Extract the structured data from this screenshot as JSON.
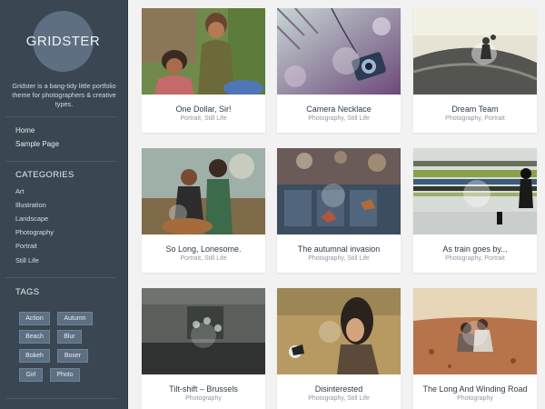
{
  "site": {
    "logo_text": "GRIDSTER",
    "tagline": "Gridster is a bang-tidy little portfolio theme for photographers & creative types."
  },
  "menu": [
    "Home",
    "Sample Page"
  ],
  "categories": {
    "title": "CATEGORIES",
    "items": [
      "Art",
      "Illustration",
      "Landscape",
      "Photography",
      "Portrait",
      "Still Life"
    ]
  },
  "tags": {
    "title": "TAGS",
    "items": [
      "Action",
      "Autumn",
      "Beach",
      "Blur",
      "Bokeh",
      "Boxer",
      "Girl",
      "Photo"
    ]
  },
  "posts": [
    {
      "title": "One Dollar, Sir!",
      "meta": "Portrait, Still Life"
    },
    {
      "title": "Camera Necklace",
      "meta": "Photography, Still Life"
    },
    {
      "title": "Dream Team",
      "meta": "Photography, Portrait"
    },
    {
      "title": "So Long, Lonesome.",
      "meta": "Portrait, Still Life"
    },
    {
      "title": "The autumnal invasion",
      "meta": "Photography, Still Life"
    },
    {
      "title": "As train goes by...",
      "meta": "Photography, Portrait"
    },
    {
      "title": "Tilt-shift – Brussels",
      "meta": "Photography"
    },
    {
      "title": "Disinterested",
      "meta": "Photography, Still Life"
    },
    {
      "title": "The Long And Winding Road",
      "meta": "Photography"
    }
  ],
  "colors": {
    "sidebar": "#3a4652",
    "accent": "#5e6f82",
    "page": "#f2f2f2"
  }
}
